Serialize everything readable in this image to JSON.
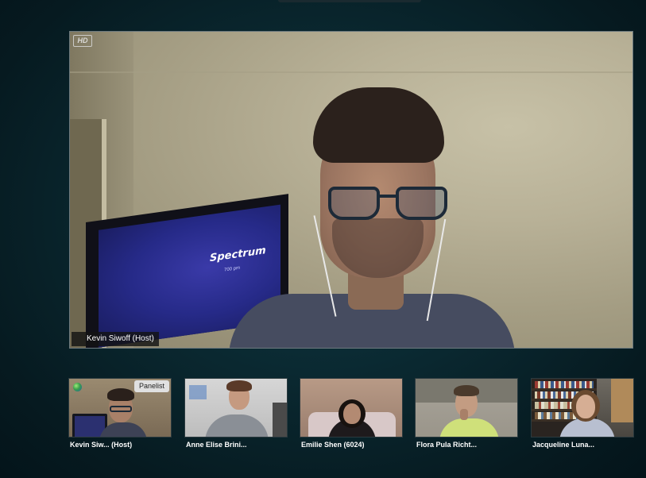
{
  "main_video": {
    "hd_label": "HD",
    "participant_name": "Kevin Siwoff (Host)",
    "tv_logo": "Spectrum",
    "tv_subtext": "700 pm"
  },
  "thumbnails": [
    {
      "name": "Kevin Siw... (Host)",
      "badge": "Panelist"
    },
    {
      "name": "Anne Elise Brini..."
    },
    {
      "name": "Emilie Shen (6024)"
    },
    {
      "name": "Flora Pula Richt..."
    },
    {
      "name": "Jacqueline Luna..."
    }
  ],
  "colors": {
    "background": "#0a2830",
    "name_tag_bg": "#141414",
    "panelist_badge_bg": "#e0e0e0"
  }
}
